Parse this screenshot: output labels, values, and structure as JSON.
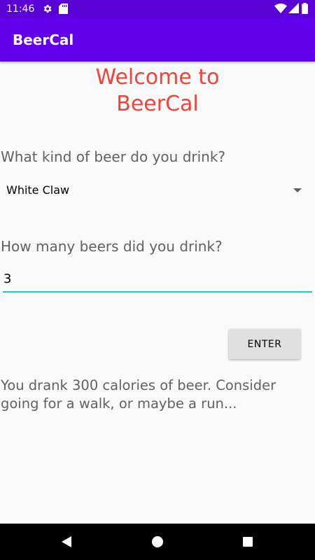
{
  "status_bar": {
    "time": "11:46",
    "icons": [
      "gear-icon",
      "sd-card-icon",
      "wifi-icon",
      "signal-icon",
      "battery-icon"
    ]
  },
  "app_bar": {
    "title": "BeerCal"
  },
  "main": {
    "welcome": "Welcome to BeerCal",
    "beer_question": "What kind of beer do you drink?",
    "beer_selected": "White Claw",
    "count_question": "How many beers did you drink?",
    "count_value": "3",
    "enter_label": "ENTER",
    "result": "You drank 300 calories of beer. Consider going for a walk, or maybe a run..."
  },
  "colors": {
    "status_bar": "#5a02d6",
    "app_bar": "#6200ee",
    "welcome_text": "#f44336",
    "input_underline": "#03dac5",
    "button_bg": "#e0e0e0"
  },
  "nav_bar": {
    "icons": [
      "back-icon",
      "home-icon",
      "recents-icon"
    ]
  }
}
